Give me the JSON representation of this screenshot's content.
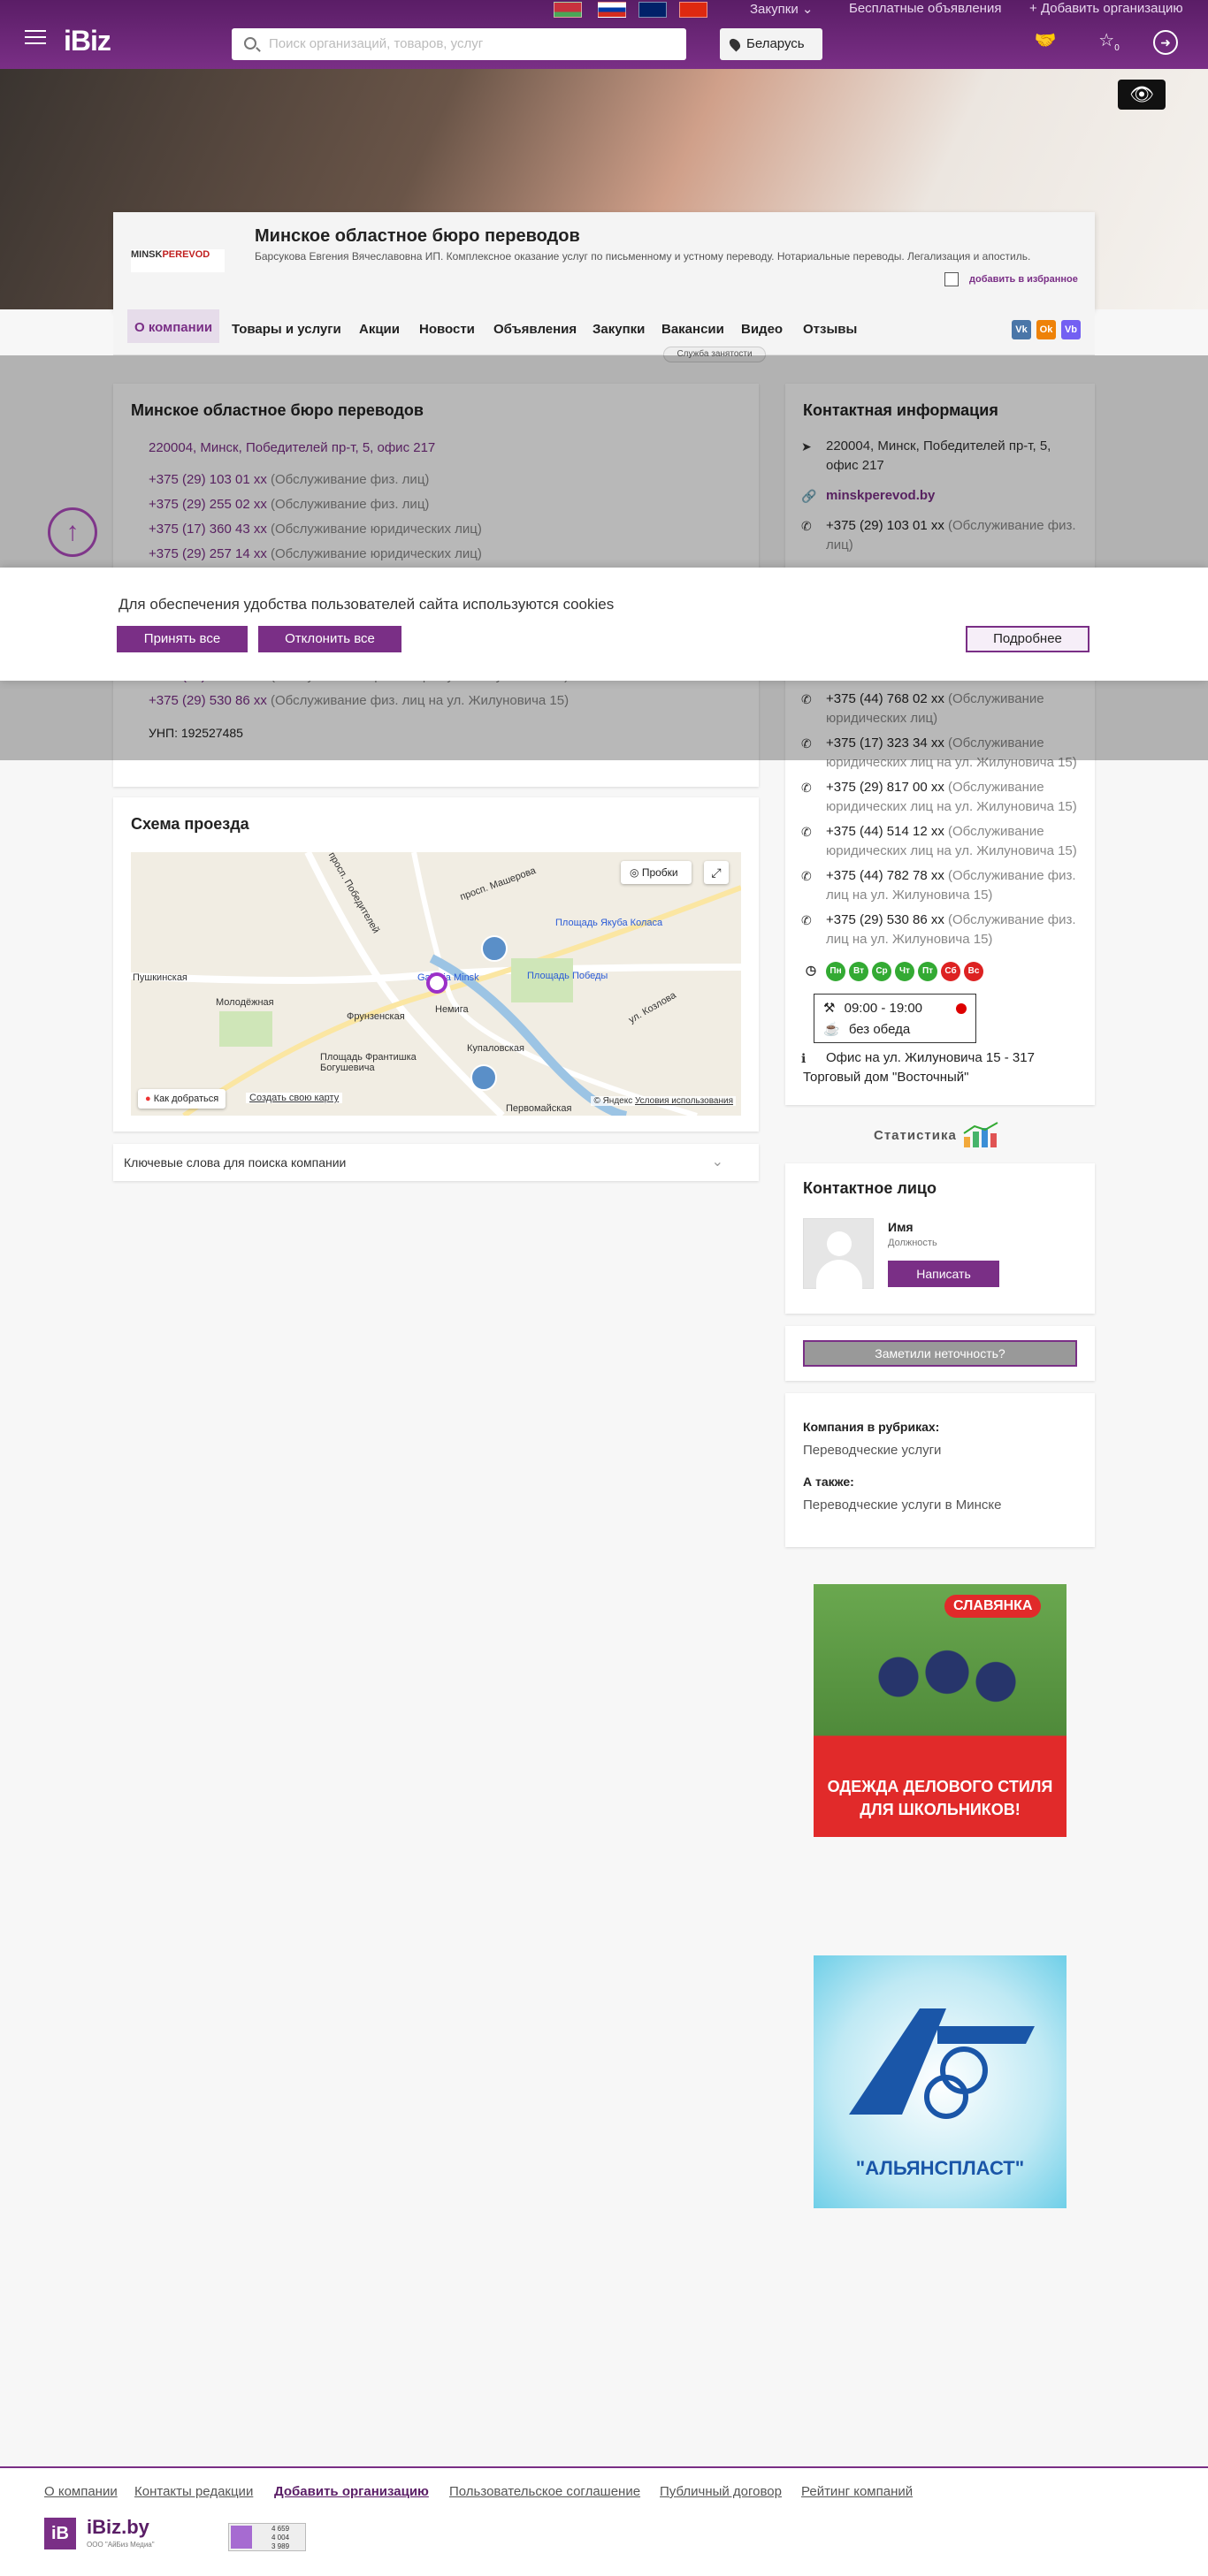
{
  "header": {
    "purchases": "Закупки",
    "free_ads": "Бесплатные объявления",
    "add_org": "Добавить организацию",
    "logo": "iBiz",
    "search_placeholder": "Поиск организаций, товаров, услуг",
    "country": "Беларусь",
    "fav_count": "0"
  },
  "company": {
    "name": "Минское областное бюро переводов",
    "description": "Барсукова Евгения Вячеславовна ИП. Комплексное оказание услуг по письменному и устному переводу. Нотариальные переводы. Легализация и апостиль.",
    "add_fav": "добавить в избранное",
    "logo_text": "MINSK",
    "logo_text_red": "PEREVOD",
    "busy": "Служба занятости"
  },
  "tabs": [
    "О компании",
    "Товары и услуги",
    "Акции",
    "Новости",
    "Объявления",
    "Закупки",
    "Вакансии",
    "Видео",
    "Отзывы"
  ],
  "social": [
    "Vk",
    "Ok",
    "Vb"
  ],
  "about": {
    "title": "Минское областное бюро переводов",
    "address": "220004, Минск, Победителей пр-т, 5, офис 217",
    "phones": [
      {
        "num": "+375 (29) 103 01 xx",
        "note": "(Обслуживание физ. лиц)"
      },
      {
        "num": "+375 (29) 255 02 xx",
        "note": "(Обслуживание физ. лиц)"
      },
      {
        "num": "+375 (17) 360 43 xx",
        "note": "(Обслуживание юридических лиц)"
      },
      {
        "num": "+375 (29) 257 14 xx",
        "note": "(Обслуживание юридических лиц)"
      }
    ],
    "phones_tail": [
      {
        "num": "+375 (44) 782 78 xx",
        "note": "(Обслуживание физ. лиц на ул. Жилуновича 15)"
      },
      {
        "num": "+375 (29) 530 86 xx",
        "note": "(Обслуживание физ. лиц на ул. Жилуновича 15)"
      }
    ],
    "unp": "УНП: 192527485"
  },
  "contact": {
    "title": "Контактная информация",
    "address": "220004, Минск, Победителей пр-т, 5, офис 217",
    "site": "minskperevod.by",
    "phones": [
      {
        "num": "+375 (29) 103 01 xx",
        "note": "(Обслуживание физ. лиц)"
      },
      {
        "num": "+375 (44) 768 02 xx",
        "note": "(Обслуживание юридических лиц)"
      },
      {
        "num": "+375 (17) 323 34 xx",
        "note": "(Обслуживание юридических лиц на ул. Жилуновича 15)"
      },
      {
        "num": "+375 (29) 817 00 xx",
        "note": "(Обслуживание юридических лиц на ул. Жилуновича 15)"
      },
      {
        "num": "+375 (44) 514 12 xx",
        "note": "(Обслуживание юридических лиц на ул. Жилуновича 15)"
      },
      {
        "num": "+375 (44) 782 78 xx",
        "note": "(Обслуживание физ. лиц на ул. Жилуновича 15)"
      },
      {
        "num": "+375 (29) 530 86 xx",
        "note": "(Обслуживание физ. лиц на ул. Жилуновича 15)"
      }
    ],
    "partial_note": "юридических лиц)",
    "days": [
      "Пн",
      "Вт",
      "Ср",
      "Чт",
      "Пт",
      "Сб",
      "Вс"
    ],
    "hours": "09:00 - 19:00",
    "lunch": "без обеда",
    "office": "Офис на ул. Жилуновича 15 - 317",
    "office2": "Торговый дом \"Восточный\""
  },
  "cookie": {
    "text": "Для обеспечения удобства пользователей сайта используются cookies",
    "accept": "Принять все",
    "decline": "Отклонить все",
    "more": "Подробнее"
  },
  "map": {
    "title": "Схема проезда",
    "traffic": "Пробки",
    "route": "Как добраться",
    "create": "Создать свою карту",
    "copy": "© Яндекс",
    "terms": "Условия использования",
    "labels": [
      "Пушкинская",
      "Молодёжная",
      "Фрунзенская",
      "Немига",
      "Площадь Победы",
      "Площадь Якуба Коласа",
      "Площадь Франтишка Богушевича",
      "Купаловская",
      "Первомайская",
      "просп. Машерова",
      "просп. Победителей",
      "ул. Козлова",
      "Galleria Minsk"
    ]
  },
  "keywords": "Ключевые слова для поиска компании",
  "stats": "Статистика",
  "person": {
    "title": "Контактное лицо",
    "name": "Имя",
    "position": "Должность",
    "write": "Написать"
  },
  "report": "Заметили неточность?",
  "rubrics": {
    "title": "Компания в рубриках:",
    "item": "Переводческие услуги",
    "also": "А также:",
    "also_item": "Переводческие услуги в Минске"
  },
  "ads": {
    "ad1_brand": "СЛАВЯНКА",
    "ad1_text": "ОДЕЖДА ДЕЛОВОГО СТИЛЯ ДЛЯ ШКОЛЬНИКОВ!",
    "ad2_brand": "\"АЛЬЯНСПЛАСТ\""
  },
  "footer": {
    "links": [
      "О компании",
      "Контакты редакции",
      "Добавить организацию",
      "Пользовательское соглашение",
      "Публичный договор",
      "Рейтинг компаний"
    ],
    "brand": "iBiz.by",
    "sub": "ООО \"АйБиз Медиа\"",
    "logo_mark": "iB",
    "counter": [
      "4 659",
      "4 004",
      "3 989"
    ]
  },
  "colors": {
    "brand": "#7a2f86",
    "header": "#5a1d66"
  }
}
